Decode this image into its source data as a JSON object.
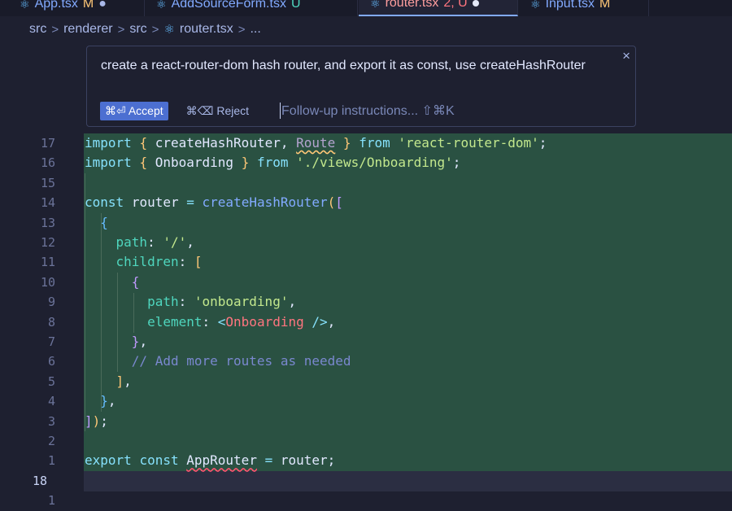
{
  "tabs": [
    {
      "name": "App.tsx",
      "status": "M",
      "extra": "●"
    },
    {
      "name": "AddSourceForm.tsx",
      "status": "U",
      "extra": ""
    },
    {
      "name": "router.tsx",
      "status": "2, U",
      "extra": ""
    },
    {
      "name": "Input.tsx",
      "status": "M",
      "extra": ""
    }
  ],
  "breadcrumb": {
    "parts": [
      "src",
      "renderer",
      "src",
      "router.tsx",
      "..."
    ],
    "separator": ">"
  },
  "prompt": {
    "text": "create a react-router-dom hash router, and export it as const, use createHashRouter",
    "accept_label": "⌘⏎ Accept",
    "reject_label": "⌘⌫ Reject",
    "followup_placeholder": "Follow-up instructions... ⇧⌘K",
    "close_icon": "×"
  },
  "editor": {
    "line_numbers": [
      "17",
      "16",
      "15",
      "14",
      "13",
      "12",
      "11",
      "10",
      "9",
      "8",
      "7",
      "6",
      "5",
      "4",
      "3",
      "2",
      "1",
      "18",
      "1"
    ],
    "current_line_number": "18",
    "code": {
      "l1_import": "import",
      "l1_named": "createHashRouter",
      "l1_route": "Route",
      "l1_from": "from",
      "l1_module": "'react-router-dom'",
      "l2_import": "import",
      "l2_named": "Onboarding",
      "l2_from": "from",
      "l2_module": "'./views/Onboarding'",
      "l4_const": "const",
      "l4_var": "router",
      "l4_fn": "createHashRouter",
      "l6_key": "path",
      "l6_val": "'/'",
      "l7_key": "children",
      "l9_key": "path",
      "l9_val": "'onboarding'",
      "l10_key": "element",
      "l10_tag": "Onboarding",
      "l12_comment": "// Add more routes as needed",
      "l17_export": "export",
      "l17_const": "const",
      "l17_var": "AppRouter",
      "l17_val": "router"
    }
  }
}
